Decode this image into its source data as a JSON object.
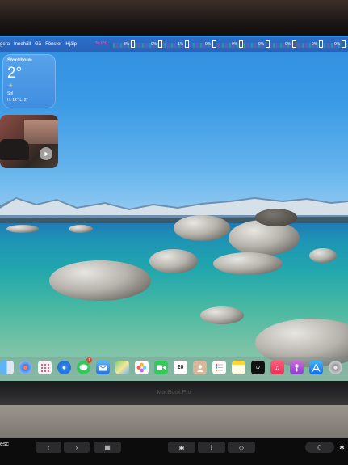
{
  "menubar": {
    "items": [
      "gera",
      "Innehåll",
      "Gå",
      "Fönster",
      "Hjälp"
    ],
    "temperature": "34.0°C",
    "stats": [
      "3%",
      "0%",
      "1%",
      "0%",
      "0%",
      "0%",
      "0%",
      "0%",
      "0%"
    ]
  },
  "weather_widget": {
    "city": "Stockholm",
    "temperature": "2°",
    "condition": "Sol",
    "high_low": "H: 12° L: 2°"
  },
  "dock": {
    "calendar_day": "20",
    "messages_badge": "1",
    "appletv_label": "tv"
  },
  "hardware": {
    "brand_label": "MacBook Pro",
    "esc_label": "esc"
  }
}
